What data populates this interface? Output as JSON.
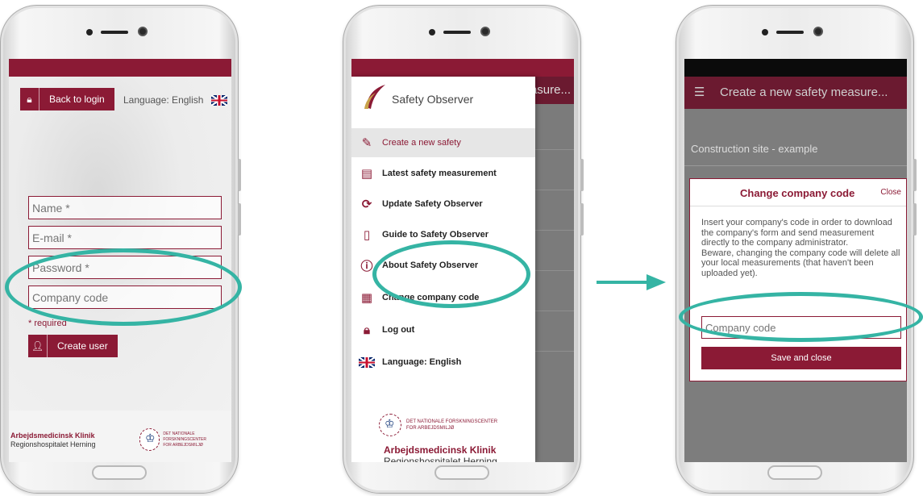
{
  "colors": {
    "brand": "#8b1a35",
    "highlight": "#35b4a4"
  },
  "login": {
    "back_button": "Back to login",
    "back_icon": "lock-icon",
    "language_label": "Language: English",
    "name_placeholder": "Name *",
    "email_placeholder": "E-mail *",
    "password_placeholder": "Password *",
    "company_placeholder": "Company code",
    "required_note": "* required",
    "create_button": "Create user",
    "create_icon": "add-user-icon",
    "footer_org": "Arbejdsmedicinsk Klinik",
    "footer_sub": "Regionshospitalet Herning",
    "footer_center": "DET NATIONALE FORSKNINGSCENTER",
    "footer_center_sub": "FOR ARBEJDSMILJØ"
  },
  "drawer": {
    "app_title": "Safety Observer",
    "behind_title": "asure...",
    "items": [
      {
        "label": "Create a new safety",
        "icon": "edit-icon"
      },
      {
        "label": "Latest safety measurement",
        "icon": "clipboard-icon"
      },
      {
        "label": "Update Safety Observer",
        "icon": "refresh-icon"
      },
      {
        "label": "Guide to Safety Observer",
        "icon": "document-icon"
      },
      {
        "label": "About Safety Observer",
        "icon": "help-icon"
      },
      {
        "label": "Change company code",
        "icon": "briefcase-icon"
      },
      {
        "label": "Log out",
        "icon": "lock-icon"
      },
      {
        "label": "Language: English",
        "icon": "uk-flag-icon"
      }
    ],
    "footer_center": "DET NATIONALE FORSKNINGSCENTER",
    "footer_center_sub": "FOR ARBEJDSMILJØ",
    "footer_org": "Arbejdsmedicinsk Klinik",
    "footer_sub": "Regionshospitalet Herning"
  },
  "change_code": {
    "appbar_title": "Create a new safety measure...",
    "site_label": "Construction site - example",
    "dialog_title": "Change company code",
    "close_label": "Close",
    "body_text": "Insert your company's code in order to download the company's form and send measurement directly to the company administrator.",
    "warning_text": "Beware, changing the company code will delete all your local measurements (that haven't been uploaded yet).",
    "input_placeholder": "Company code",
    "save_button": "Save and close"
  }
}
